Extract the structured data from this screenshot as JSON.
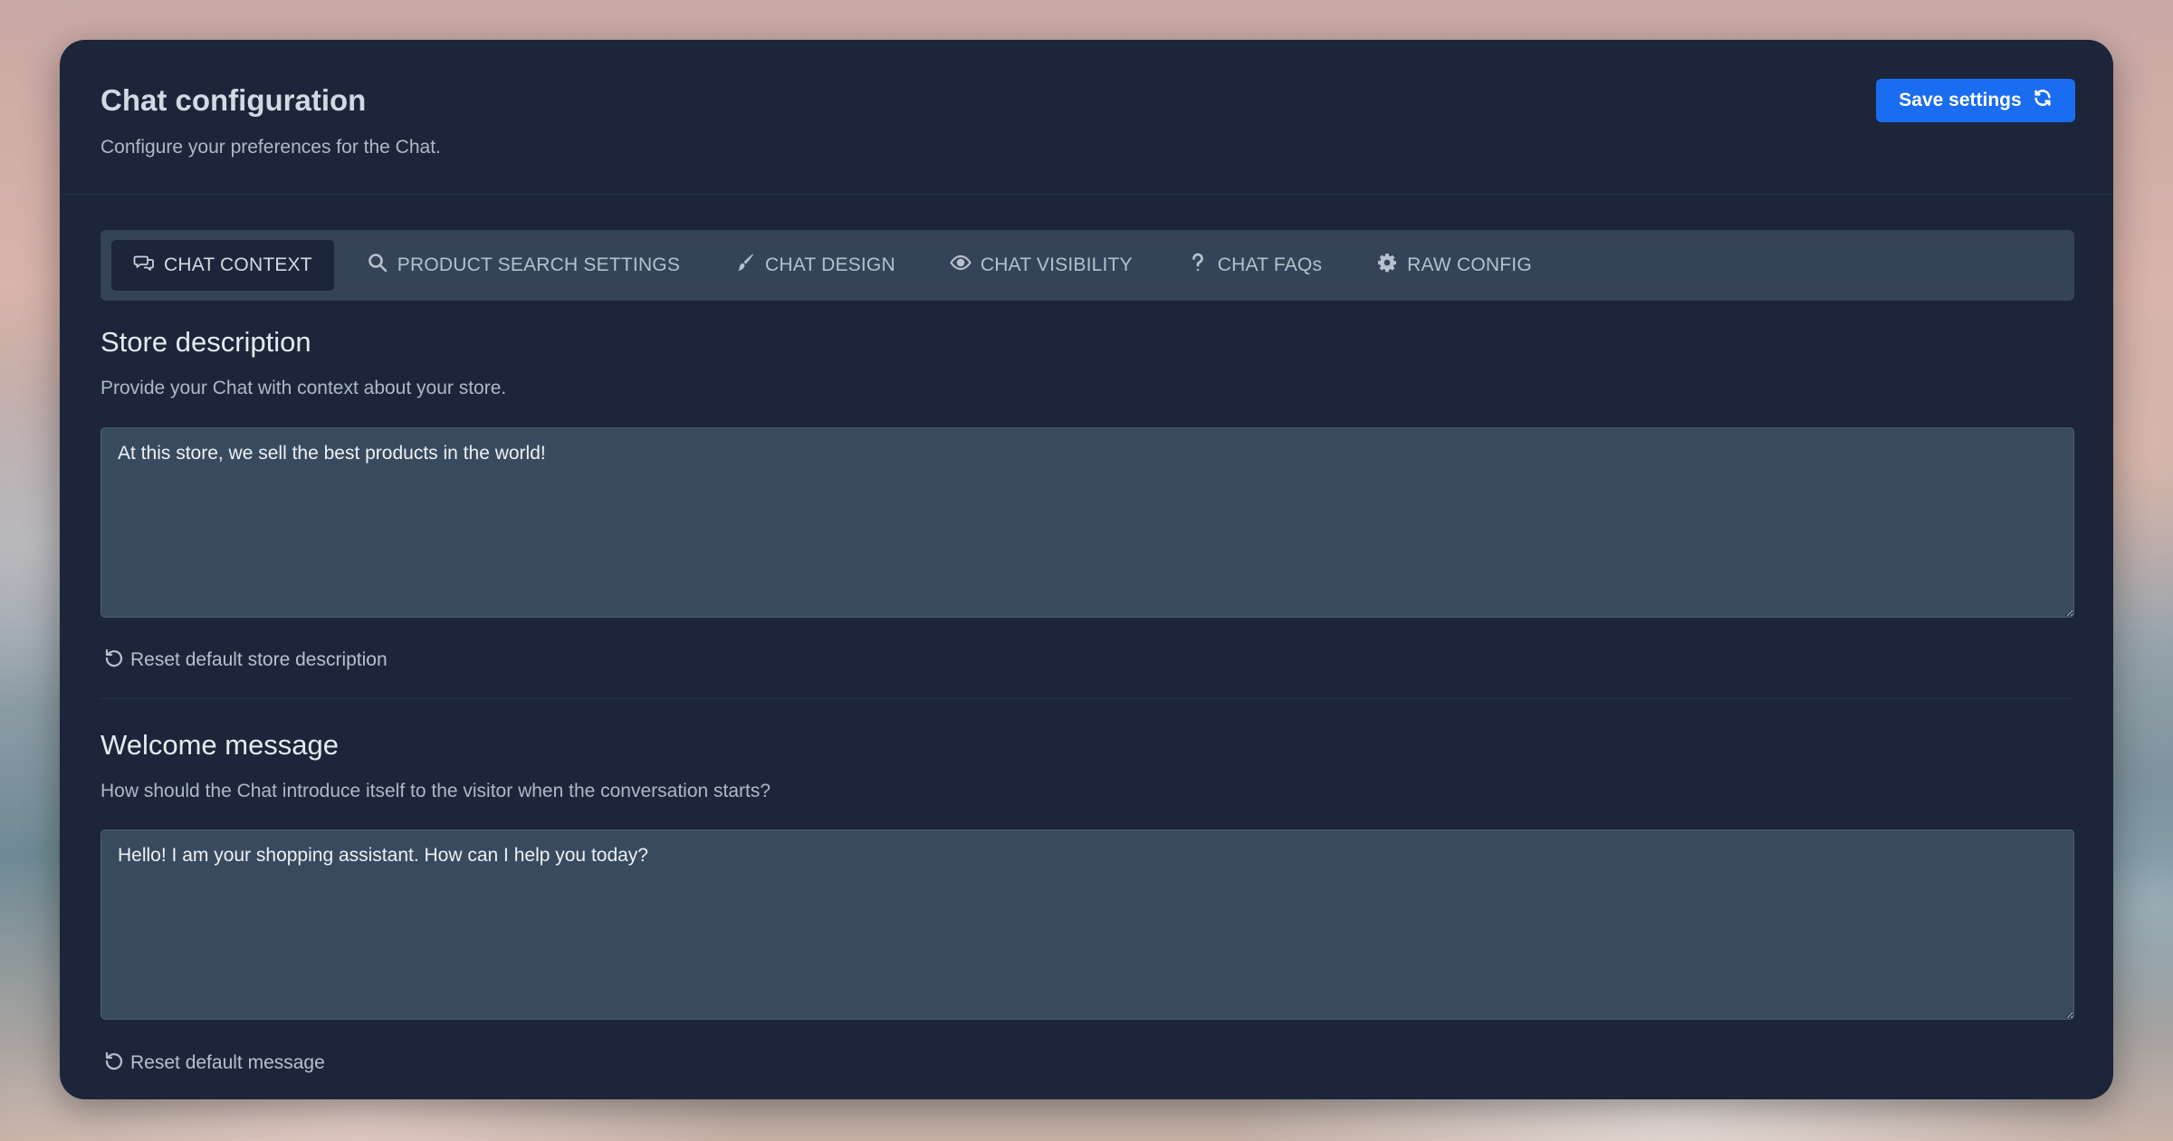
{
  "header": {
    "title": "Chat configuration",
    "subtitle": "Configure your preferences for the Chat.",
    "save_label": "Save settings"
  },
  "tabs": [
    {
      "label": "CHAT CONTEXT",
      "icon": "chat-bubbles-icon",
      "active": true
    },
    {
      "label": "PRODUCT SEARCH SETTINGS",
      "icon": "search-icon",
      "active": false
    },
    {
      "label": "CHAT DESIGN",
      "icon": "paintbrush-icon",
      "active": false
    },
    {
      "label": "CHAT VISIBILITY",
      "icon": "eye-icon",
      "active": false
    },
    {
      "label": "CHAT FAQs",
      "icon": "question-icon",
      "active": false
    },
    {
      "label": "RAW CONFIG",
      "icon": "gear-icon",
      "active": false
    }
  ],
  "store_description": {
    "title": "Store description",
    "description": "Provide your Chat with context about your store.",
    "value": "At this store, we sell the best products in the world!",
    "reset_label": "Reset default store description"
  },
  "welcome_message": {
    "title": "Welcome message",
    "description": "How should the Chat introduce itself to the visitor when the conversation starts?",
    "value": "Hello! I am your shopping assistant. How can I help you today?",
    "reset_label": "Reset default message"
  },
  "colors": {
    "panel": "#1c2539",
    "accent": "#1a6cf0",
    "tabbar": "#344357",
    "field": "#384a5e"
  }
}
